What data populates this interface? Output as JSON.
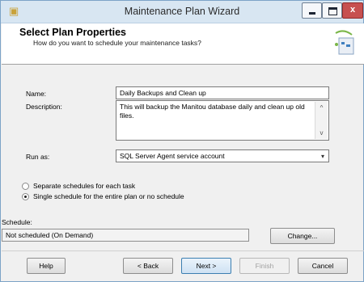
{
  "window": {
    "title": "Maintenance Plan Wizard",
    "close_glyph": "x"
  },
  "header": {
    "title": "Select Plan Properties",
    "subtitle": "How do you want to schedule your maintenance tasks?",
    "icon": "wizard-graphic-icon"
  },
  "form": {
    "name_label": "Name:",
    "name_value": "Daily Backups and Clean up",
    "description_label": "Description:",
    "description_value": "This will backup the Manitou database daily and clean up old files.",
    "run_as_label": "Run as:",
    "run_as_value": "SQL Server Agent service account"
  },
  "schedule_options": [
    {
      "label": "Separate schedules for each task",
      "selected": false
    },
    {
      "label": "Single schedule for the entire plan or no schedule",
      "selected": true
    }
  ],
  "schedule": {
    "label": "Schedule:",
    "value": "Not scheduled (On Demand)",
    "change_label": "Change..."
  },
  "footer": {
    "help": "Help",
    "back": "< Back",
    "next": "Next >",
    "finish": "Finish",
    "cancel": "Cancel"
  },
  "colors": {
    "title_bar": "#d8e6f2",
    "close_button": "#c75050",
    "dialog_bg": "#f0f0f0"
  }
}
